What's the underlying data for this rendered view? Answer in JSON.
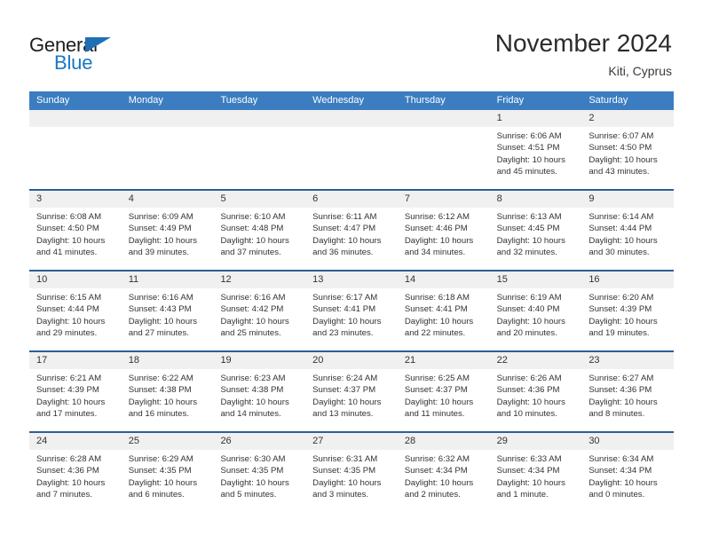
{
  "brand": {
    "name_part1": "General",
    "name_part2": "Blue",
    "triangle_icon": "triangle-icon",
    "accent_color": "#1878c4"
  },
  "header": {
    "month_title": "November 2024",
    "location": "Kiti, Cyprus"
  },
  "theme": {
    "header_blue": "#3b7dc0",
    "week_divider_blue": "#2b5f96",
    "daynum_band": "#f0f0f0"
  },
  "calendar": {
    "weekdays": [
      "Sunday",
      "Monday",
      "Tuesday",
      "Wednesday",
      "Thursday",
      "Friday",
      "Saturday"
    ],
    "weeks": [
      [
        {
          "day": "",
          "empty": true
        },
        {
          "day": "",
          "empty": true
        },
        {
          "day": "",
          "empty": true
        },
        {
          "day": "",
          "empty": true
        },
        {
          "day": "",
          "empty": true
        },
        {
          "day": "1",
          "sunrise": "Sunrise: 6:06 AM",
          "sunset": "Sunset: 4:51 PM",
          "daylight": "Daylight: 10 hours and 45 minutes."
        },
        {
          "day": "2",
          "sunrise": "Sunrise: 6:07 AM",
          "sunset": "Sunset: 4:50 PM",
          "daylight": "Daylight: 10 hours and 43 minutes."
        }
      ],
      [
        {
          "day": "3",
          "sunrise": "Sunrise: 6:08 AM",
          "sunset": "Sunset: 4:50 PM",
          "daylight": "Daylight: 10 hours and 41 minutes."
        },
        {
          "day": "4",
          "sunrise": "Sunrise: 6:09 AM",
          "sunset": "Sunset: 4:49 PM",
          "daylight": "Daylight: 10 hours and 39 minutes."
        },
        {
          "day": "5",
          "sunrise": "Sunrise: 6:10 AM",
          "sunset": "Sunset: 4:48 PM",
          "daylight": "Daylight: 10 hours and 37 minutes."
        },
        {
          "day": "6",
          "sunrise": "Sunrise: 6:11 AM",
          "sunset": "Sunset: 4:47 PM",
          "daylight": "Daylight: 10 hours and 36 minutes."
        },
        {
          "day": "7",
          "sunrise": "Sunrise: 6:12 AM",
          "sunset": "Sunset: 4:46 PM",
          "daylight": "Daylight: 10 hours and 34 minutes."
        },
        {
          "day": "8",
          "sunrise": "Sunrise: 6:13 AM",
          "sunset": "Sunset: 4:45 PM",
          "daylight": "Daylight: 10 hours and 32 minutes."
        },
        {
          "day": "9",
          "sunrise": "Sunrise: 6:14 AM",
          "sunset": "Sunset: 4:44 PM",
          "daylight": "Daylight: 10 hours and 30 minutes."
        }
      ],
      [
        {
          "day": "10",
          "sunrise": "Sunrise: 6:15 AM",
          "sunset": "Sunset: 4:44 PM",
          "daylight": "Daylight: 10 hours and 29 minutes."
        },
        {
          "day": "11",
          "sunrise": "Sunrise: 6:16 AM",
          "sunset": "Sunset: 4:43 PM",
          "daylight": "Daylight: 10 hours and 27 minutes."
        },
        {
          "day": "12",
          "sunrise": "Sunrise: 6:16 AM",
          "sunset": "Sunset: 4:42 PM",
          "daylight": "Daylight: 10 hours and 25 minutes."
        },
        {
          "day": "13",
          "sunrise": "Sunrise: 6:17 AM",
          "sunset": "Sunset: 4:41 PM",
          "daylight": "Daylight: 10 hours and 23 minutes."
        },
        {
          "day": "14",
          "sunrise": "Sunrise: 6:18 AM",
          "sunset": "Sunset: 4:41 PM",
          "daylight": "Daylight: 10 hours and 22 minutes."
        },
        {
          "day": "15",
          "sunrise": "Sunrise: 6:19 AM",
          "sunset": "Sunset: 4:40 PM",
          "daylight": "Daylight: 10 hours and 20 minutes."
        },
        {
          "day": "16",
          "sunrise": "Sunrise: 6:20 AM",
          "sunset": "Sunset: 4:39 PM",
          "daylight": "Daylight: 10 hours and 19 minutes."
        }
      ],
      [
        {
          "day": "17",
          "sunrise": "Sunrise: 6:21 AM",
          "sunset": "Sunset: 4:39 PM",
          "daylight": "Daylight: 10 hours and 17 minutes."
        },
        {
          "day": "18",
          "sunrise": "Sunrise: 6:22 AM",
          "sunset": "Sunset: 4:38 PM",
          "daylight": "Daylight: 10 hours and 16 minutes."
        },
        {
          "day": "19",
          "sunrise": "Sunrise: 6:23 AM",
          "sunset": "Sunset: 4:38 PM",
          "daylight": "Daylight: 10 hours and 14 minutes."
        },
        {
          "day": "20",
          "sunrise": "Sunrise: 6:24 AM",
          "sunset": "Sunset: 4:37 PM",
          "daylight": "Daylight: 10 hours and 13 minutes."
        },
        {
          "day": "21",
          "sunrise": "Sunrise: 6:25 AM",
          "sunset": "Sunset: 4:37 PM",
          "daylight": "Daylight: 10 hours and 11 minutes."
        },
        {
          "day": "22",
          "sunrise": "Sunrise: 6:26 AM",
          "sunset": "Sunset: 4:36 PM",
          "daylight": "Daylight: 10 hours and 10 minutes."
        },
        {
          "day": "23",
          "sunrise": "Sunrise: 6:27 AM",
          "sunset": "Sunset: 4:36 PM",
          "daylight": "Daylight: 10 hours and 8 minutes."
        }
      ],
      [
        {
          "day": "24",
          "sunrise": "Sunrise: 6:28 AM",
          "sunset": "Sunset: 4:36 PM",
          "daylight": "Daylight: 10 hours and 7 minutes."
        },
        {
          "day": "25",
          "sunrise": "Sunrise: 6:29 AM",
          "sunset": "Sunset: 4:35 PM",
          "daylight": "Daylight: 10 hours and 6 minutes."
        },
        {
          "day": "26",
          "sunrise": "Sunrise: 6:30 AM",
          "sunset": "Sunset: 4:35 PM",
          "daylight": "Daylight: 10 hours and 5 minutes."
        },
        {
          "day": "27",
          "sunrise": "Sunrise: 6:31 AM",
          "sunset": "Sunset: 4:35 PM",
          "daylight": "Daylight: 10 hours and 3 minutes."
        },
        {
          "day": "28",
          "sunrise": "Sunrise: 6:32 AM",
          "sunset": "Sunset: 4:34 PM",
          "daylight": "Daylight: 10 hours and 2 minutes."
        },
        {
          "day": "29",
          "sunrise": "Sunrise: 6:33 AM",
          "sunset": "Sunset: 4:34 PM",
          "daylight": "Daylight: 10 hours and 1 minute."
        },
        {
          "day": "30",
          "sunrise": "Sunrise: 6:34 AM",
          "sunset": "Sunset: 4:34 PM",
          "daylight": "Daylight: 10 hours and 0 minutes."
        }
      ]
    ]
  }
}
